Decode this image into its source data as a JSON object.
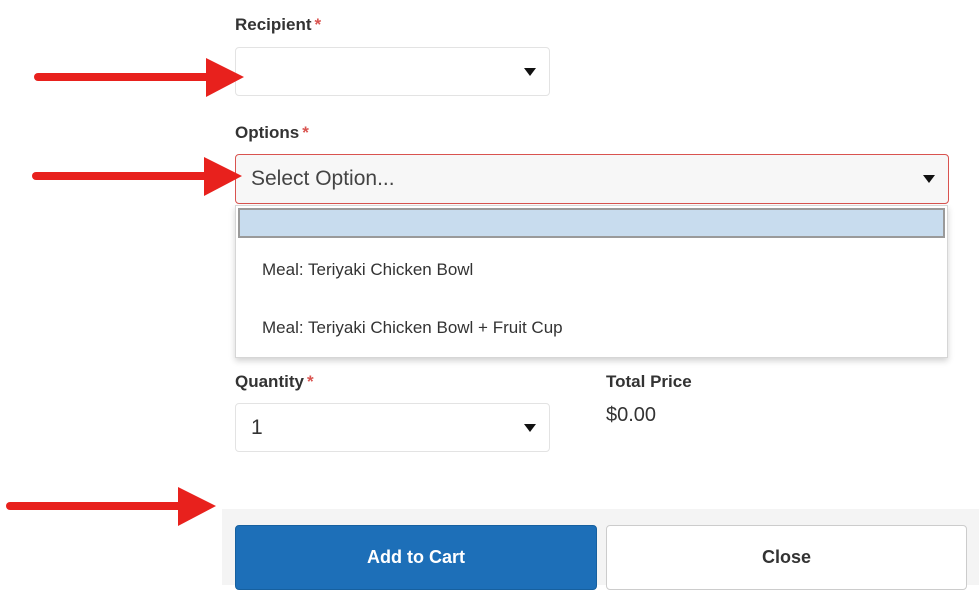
{
  "form": {
    "recipient": {
      "label": "Recipient",
      "required_mark": "*",
      "value": ""
    },
    "options": {
      "label": "Options",
      "required_mark": "*",
      "placeholder": "Select Option...",
      "dropdown_items": [
        "",
        "Meal: Teriyaki Chicken Bowl",
        "Meal: Teriyaki Chicken Bowl + Fruit Cup"
      ]
    },
    "quantity": {
      "label": "Quantity",
      "required_mark": "*",
      "value": "1"
    },
    "total_price": {
      "label": "Total Price",
      "value": "$0.00"
    }
  },
  "buttons": {
    "add_to_cart": "Add to Cart",
    "close": "Close"
  },
  "annotations": {
    "arrow_color": "#e8211d",
    "count": 3
  },
  "colors": {
    "primary_button": "#1d6fb8",
    "required_asterisk": "#d9534f",
    "invalid_border": "#d9534f",
    "highlight_option": "#c8dcee"
  }
}
